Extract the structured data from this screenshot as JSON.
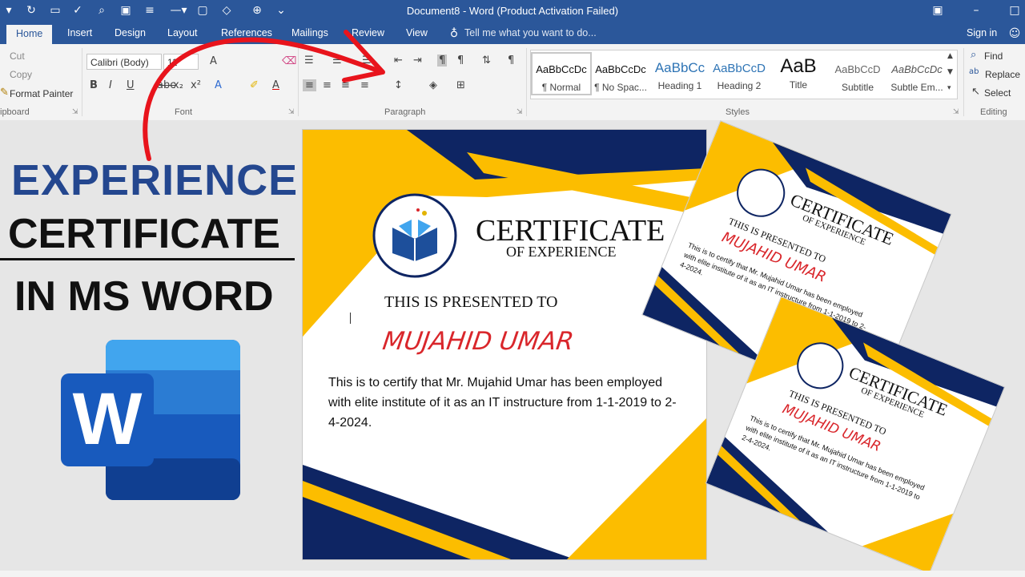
{
  "window": {
    "title": "Document8 - Word (Product Activation Failed)"
  },
  "tabs": [
    {
      "label": "Home",
      "active": true
    },
    {
      "label": "Insert"
    },
    {
      "label": "Design"
    },
    {
      "label": "Layout"
    },
    {
      "label": "References"
    },
    {
      "label": "Mailings"
    },
    {
      "label": "Review"
    },
    {
      "label": "View"
    }
  ],
  "tell_me": "Tell me what you want to do...",
  "sign_in": "Sign in",
  "clipboard": {
    "cut": "Cut",
    "copy": "Copy",
    "format_painter": "Format Painter",
    "group": "ipboard"
  },
  "font": {
    "family": "Calibri (Body)",
    "size": "11",
    "group": "Font"
  },
  "paragraph": {
    "group": "Paragraph"
  },
  "styles": {
    "group": "Styles",
    "items": [
      {
        "preview": "AaBbCcDc",
        "name": "¶ Normal"
      },
      {
        "preview": "AaBbCcDc",
        "name": "¶ No Spac..."
      },
      {
        "preview": "AaBbCc",
        "name": "Heading 1"
      },
      {
        "preview": "AaBbCcD",
        "name": "Heading 2"
      },
      {
        "preview": "AaB",
        "name": "Title"
      },
      {
        "preview": "AaBbCcD",
        "name": "Subtitle"
      },
      {
        "preview": "AaBbCcDc",
        "name": "Subtle Em..."
      }
    ]
  },
  "editing": {
    "find": "Find",
    "replace": "Replace",
    "select": "Select",
    "group": "Editing"
  },
  "overlay": {
    "line1": "EXPERIENCE",
    "line2": "CERTIFICATE",
    "line3": "IN MS WORD"
  },
  "certificate": {
    "title": "CERTIFICATE",
    "subtitle": "OF EXPERIENCE",
    "presented": "THIS IS PRESENTED TO",
    "name": "MUJAHID UMAR",
    "body": "This is to certify that Mr. Mujahid Umar has been employed with elite institute of it as an IT instructure from 1-1-2019 to 2-4-2024."
  },
  "colors": {
    "word_blue": "#2b579a",
    "navy": "#0e2563",
    "yellow": "#fcbd00",
    "name_red": "#d9262b",
    "title_blue": "#24478f"
  }
}
